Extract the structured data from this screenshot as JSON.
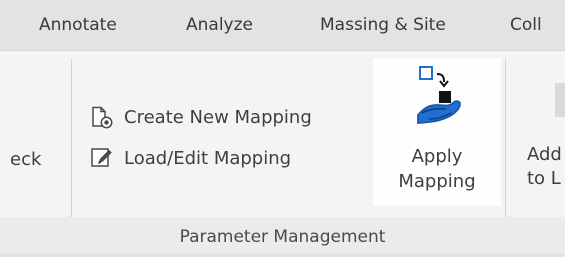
{
  "tabs": [
    {
      "label": "Annotate"
    },
    {
      "label": "Analyze"
    },
    {
      "label": "Massing & Site"
    },
    {
      "label": "Coll"
    }
  ],
  "ribbon": {
    "left_partial_label": "eck",
    "create_button_label": "Create New Mapping",
    "load_button_label": "Load/Edit Mapping",
    "apply_button": {
      "line_1": "Apply",
      "line_2": "Mapping"
    },
    "right_partial_label_1": "Add",
    "right_partial_label_2": "to L",
    "panel_title": "Parameter Management"
  },
  "icons": {
    "create": "document-add-icon",
    "load": "edit-pencil-icon",
    "apply": "hand-transfer-icon"
  },
  "colors": {
    "accent_blue": "#1f6fd1",
    "accent_blue_dark": "#145aa8",
    "apply_highlight": "#fefefe"
  }
}
